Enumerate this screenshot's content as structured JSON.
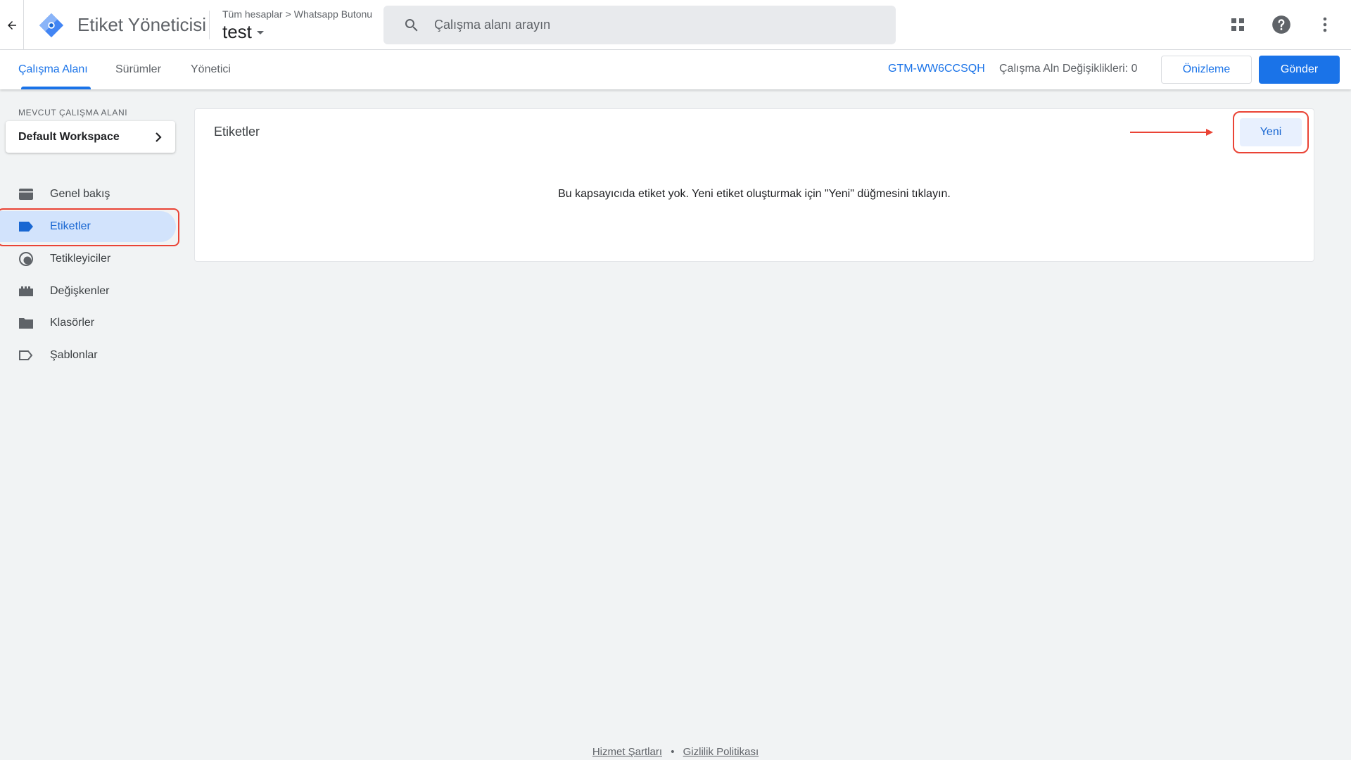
{
  "app": {
    "title": "Etiket Yöneticisi",
    "breadcrumb": [
      "Tüm hesaplar",
      "Whatsapp Butonu"
    ],
    "container_name": "test"
  },
  "search": {
    "placeholder": "Çalışma alanı arayın"
  },
  "nav": {
    "tabs": [
      {
        "label": "Çalışma Alanı",
        "active": true
      },
      {
        "label": "Sürümler",
        "active": false
      },
      {
        "label": "Yönetici",
        "active": false
      }
    ],
    "gtm_id": "GTM-WW6CCSQH",
    "workspace_changes": "Çalışma Aln Değişiklikleri: 0",
    "preview_label": "Önizleme",
    "submit_label": "Gönder"
  },
  "sidebar": {
    "workspace_label": "MEVCUT ÇALIŞMA ALANI",
    "workspace_name": "Default Workspace",
    "items": [
      {
        "label": "Genel bakış",
        "icon": "overview-icon",
        "active": false
      },
      {
        "label": "Etiketler",
        "icon": "tag-icon",
        "active": true
      },
      {
        "label": "Tetikleyiciler",
        "icon": "trigger-icon",
        "active": false
      },
      {
        "label": "Değişkenler",
        "icon": "variables-icon",
        "active": false
      },
      {
        "label": "Klasörler",
        "icon": "folder-icon",
        "active": false
      },
      {
        "label": "Şablonlar",
        "icon": "template-icon",
        "active": false
      }
    ]
  },
  "main": {
    "card_title": "Etiketler",
    "new_button": "Yeni",
    "empty_message": "Bu kapsayıcıda etiket yok. Yeni etiket oluşturmak için \"Yeni\" düğmesini tıklayın."
  },
  "footer": {
    "terms": "Hizmet Şartları",
    "separator": "•",
    "privacy": "Gizlilik Politikası"
  },
  "colors": {
    "accent": "#1a73e8",
    "highlight": "#ea4335",
    "active_bg": "#d2e3fc"
  }
}
